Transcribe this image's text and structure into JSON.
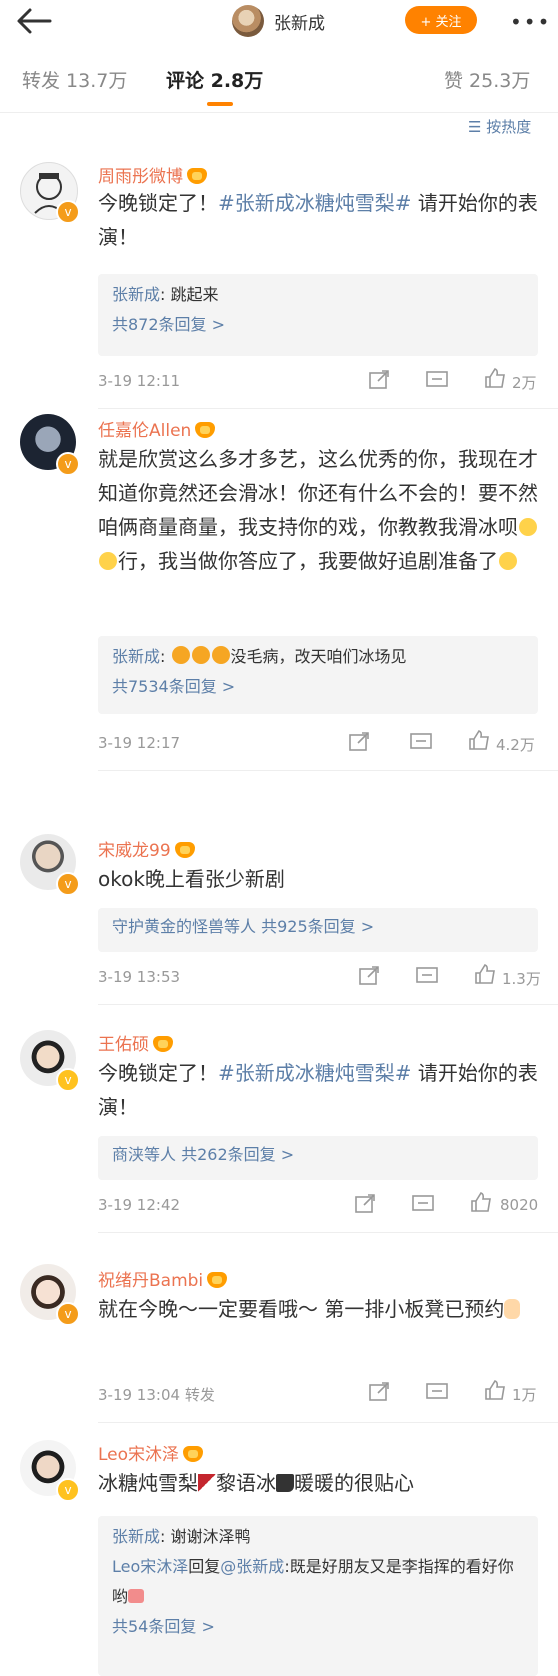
{
  "header": {
    "title": "张新成",
    "follow_label": "+ 关注",
    "more": "•••"
  },
  "tabs": [
    {
      "label": "转发 13.7万"
    },
    {
      "label": "评论 2.8万"
    },
    {
      "label": "赞 25.3万"
    }
  ],
  "sort_label": "按热度",
  "comments": [
    {
      "name": "周雨彤微博",
      "text_prefix": "今晚锁定了！",
      "topic": "#张新成冰糖炖雪梨#",
      "text_suffix": "请开始你的表演！",
      "reply_name": "张新成",
      "reply_text": ": 跳起来",
      "reply_more": "共872条回复 >",
      "time": "3-19 12:11",
      "likes": "2万"
    },
    {
      "name": "任嘉伦Allen",
      "text": "就是欣赏这么多才多艺，这么优秀的你，我现在才知道你竟然还会滑冰！你还有什么不会的！要不然咱俩商量商量，我支持你的戏，你教教我滑冰呗",
      "text2": "行，我当做你答应了，我要做好追剧准备了",
      "reply_name": "张新成",
      "reply_text": "没毛病，改天咱们冰场见",
      "reply_more": "共7534条回复 >",
      "time": "3-19 12:17",
      "likes": "4.2万"
    },
    {
      "name": "宋威龙99",
      "text": "okok晚上看张少新剧",
      "reply_more": "守护黄金的怪兽等人  共925条回复 >",
      "time": "3-19 13:53",
      "likes": "1.3万"
    },
    {
      "name": "王佑硕",
      "text_prefix": "今晚锁定了！",
      "topic": "#张新成冰糖炖雪梨#",
      "text_suffix": "请开始你的表演！",
      "reply_more": "商浃等人  共262条回复 >",
      "time": "3-19 12:42",
      "likes": "8020"
    },
    {
      "name": "祝绪丹Bambi",
      "text": "就在今晚～一定要看哦～ 第一排小板凳已预约",
      "time": "3-19 13:04",
      "forward": "转发",
      "likes": "1万"
    },
    {
      "name": "Leo宋沐泽",
      "text_a": "冰糖炖雪梨",
      "text_b": "黎语冰",
      "text_c": "暖暖的很贴心",
      "reply_name": "张新成",
      "reply_text": ": 谢谢沐泽鸭",
      "reply2_name": "Leo宋沐泽",
      "reply2_mid": "回复",
      "reply2_at": "@张新成",
      "reply2_text": ":既是好朋友又是李指挥的看好你哟",
      "reply_more": "共54条回复 >"
    }
  ],
  "colors": {
    "accent": "#ff8200",
    "link": "#5d7fa8",
    "name": "#eb7350"
  }
}
